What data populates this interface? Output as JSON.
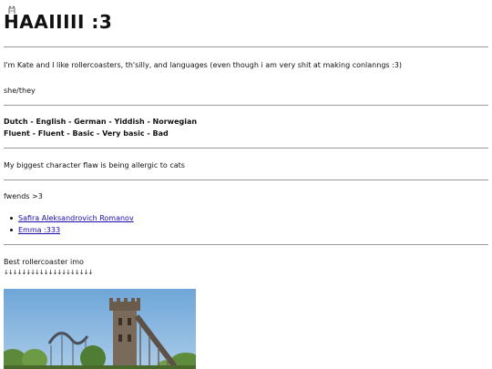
{
  "header": {
    "title": "HAAIIIII :3"
  },
  "intro": {
    "text": "I'm Kate and I like rollercoasters, th'silly, and languages (even though i am very shit at making conlanngs :3)",
    "pronouns": "she/they"
  },
  "languages": {
    "names": "Dutch - English - German - Yiddish - Norwegian",
    "levels": "Fluent - Fluent - Basic - Very basic - Bad"
  },
  "flaw": {
    "text": "My biggest character flaw is being allergic to cats"
  },
  "friends": {
    "heading": "fwends >3",
    "links": [
      {
        "label": "Safira Aleksandrovich Romanov"
      },
      {
        "label": "Emma :333"
      }
    ]
  },
  "rollercoaster": {
    "heading": "Best rollercoaster imo",
    "arrows": "↓↓↓↓↓↓↓↓↓↓↓↓↓↓↓↓↓↓↓↓"
  },
  "colors": {
    "link": "#1a0dab",
    "divider": "#9a9a9a",
    "sky": "#7fb3df"
  }
}
